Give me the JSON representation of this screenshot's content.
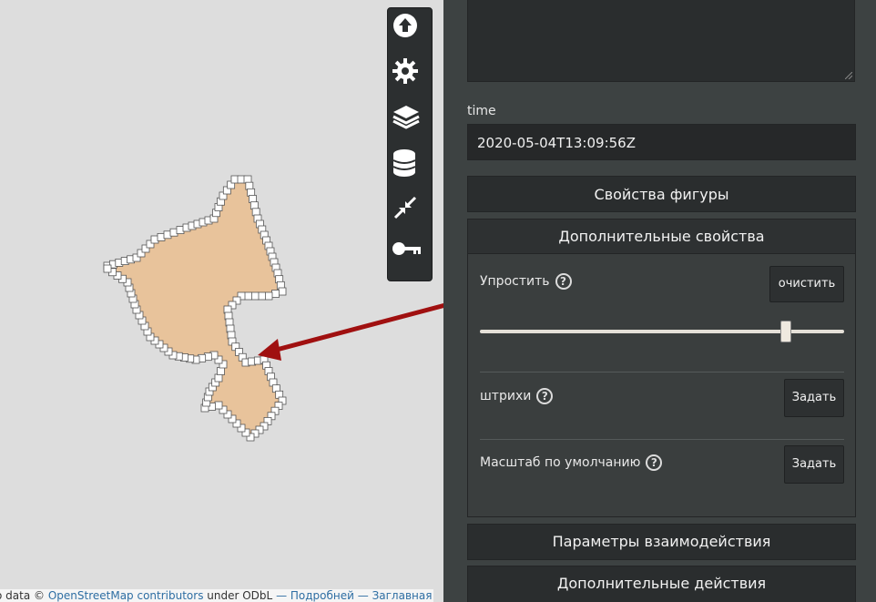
{
  "map": {
    "attribution_prefix": "o data ©",
    "osm_link": "OpenStreetMap contributors",
    "license_text": "under ODbL",
    "more_link": "— Подробней",
    "home_link": "— Заглавная"
  },
  "toolbar": {
    "icons": [
      "upload-icon",
      "gear-icon",
      "layers-icon",
      "database-icon",
      "shrink-icon",
      "key-icon"
    ]
  },
  "panel": {
    "time_label": "time",
    "time_value": "2020-05-04T13:09:56Z",
    "shape_props": "Свойства фигуры",
    "advanced_props": "Дополнительные свойства",
    "simplify_label": "Упростить",
    "clear_button": "очистить",
    "simplify_level": 0.84,
    "dash_label": "штрихи",
    "dash_button": "Задать",
    "zoom_label": "Масштаб по умолчанию",
    "zoom_button": "Задать",
    "interaction_props": "Параметры взаимодействия",
    "advanced_actions": "Дополнительные действия",
    "help_symbol": "?"
  },
  "colors": {
    "shape_fill": "#e8c39b",
    "arrow": "#a01010",
    "panel_bg": "#3d4242"
  }
}
